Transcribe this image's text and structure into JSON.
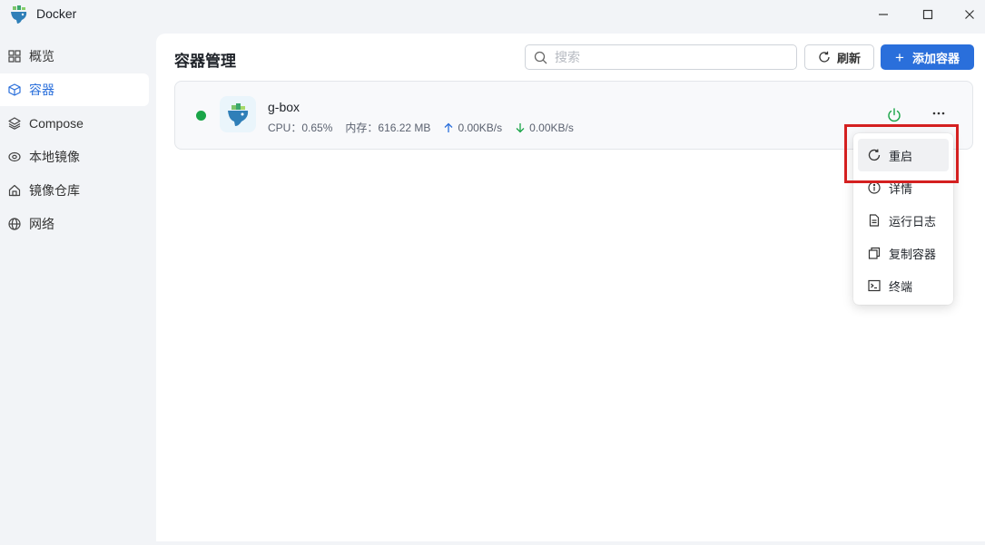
{
  "app": {
    "title": "Docker",
    "logo_icon": "docker-whale-icon"
  },
  "window_controls": [
    "minimize-icon",
    "maximize-icon",
    "close-icon"
  ],
  "sidebar": {
    "items": [
      {
        "label": "概览",
        "icon": "grid-icon",
        "active": false
      },
      {
        "label": "容器",
        "icon": "cube-icon",
        "active": true
      },
      {
        "label": "Compose",
        "icon": "layers-icon",
        "active": false
      },
      {
        "label": "本地镜像",
        "icon": "disk-icon",
        "active": false
      },
      {
        "label": "镜像仓库",
        "icon": "house-icon",
        "active": false
      },
      {
        "label": "网络",
        "icon": "globe-icon",
        "active": false
      }
    ]
  },
  "main": {
    "title": "容器管理",
    "search": {
      "placeholder": "搜索",
      "value": ""
    },
    "refresh_label": "刷新",
    "add_label": "添加容器"
  },
  "containers": [
    {
      "name": "g-box",
      "status": "running",
      "status_color": "#1aa548",
      "cpu_label": "CPU：",
      "cpu_value": "0.65%",
      "mem_label": "内存：",
      "mem_value": "616.22 MB",
      "upload": "0.00KB/s",
      "download": "0.00KB/s"
    }
  ],
  "context_menu": {
    "items": [
      {
        "label": "重启",
        "icon": "restart-icon"
      },
      {
        "label": "详情",
        "icon": "info-icon"
      },
      {
        "label": "运行日志",
        "icon": "document-icon"
      },
      {
        "label": "复制容器",
        "icon": "copy-icon"
      },
      {
        "label": "终端",
        "icon": "terminal-icon"
      }
    ]
  },
  "colors": {
    "accent": "#2a6fdb",
    "running": "#1aa548",
    "highlight_box": "#d42020",
    "background": "#f2f4f7"
  }
}
